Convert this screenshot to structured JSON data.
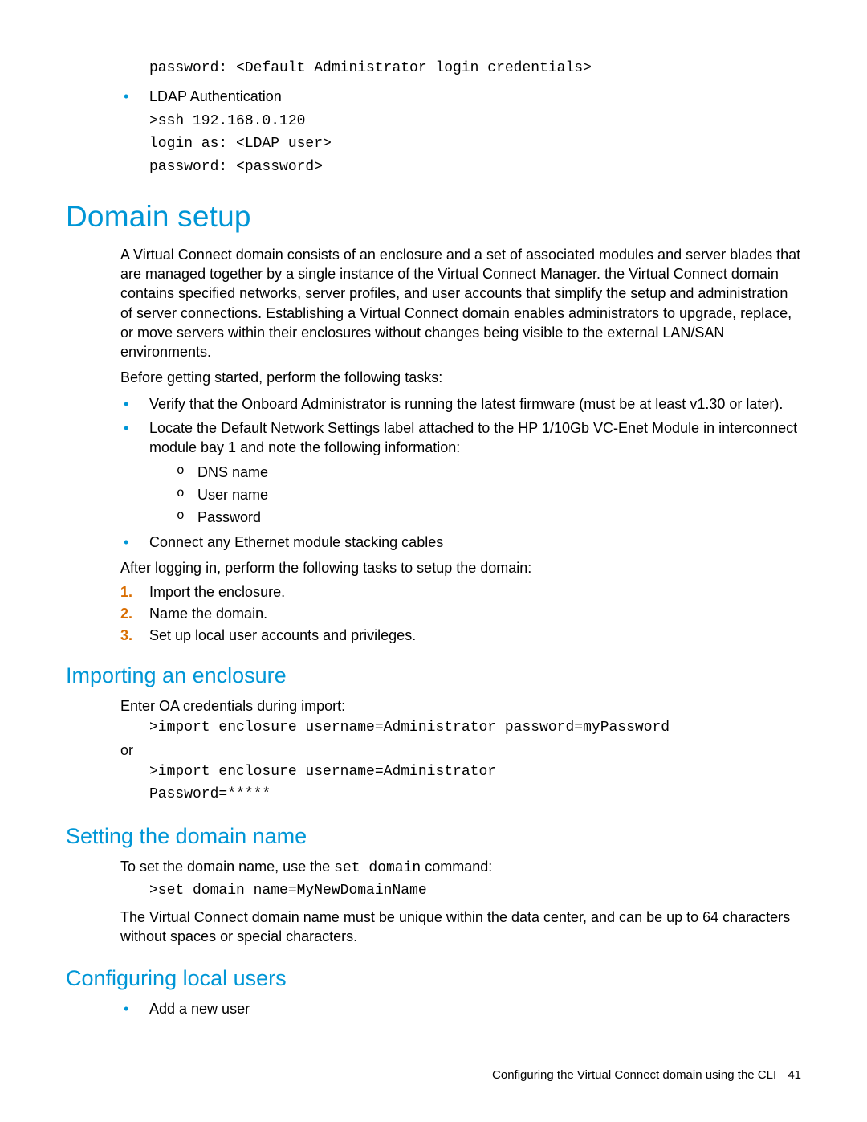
{
  "top_code": {
    "pwd_line": "password: <Default Administrator login credentials>"
  },
  "ldap": {
    "label": "LDAP Authentication",
    "l1": ">ssh 192.168.0.120",
    "l2": "login as: <LDAP user>",
    "l3": "password: <password>"
  },
  "h1_domain": "Domain setup",
  "para1": "A Virtual Connect domain consists of an enclosure and a set of associated modules and server blades that are managed together by a single instance of the Virtual Connect Manager. the Virtual Connect domain contains specified networks, server profiles, and user accounts that simplify the setup and administration of server connections. Establishing a Virtual Connect domain enables administrators to upgrade, replace, or move servers within their enclosures without changes being visible to the external LAN/SAN environments.",
  "para2": "Before getting started, perform the following tasks:",
  "pre_tasks": {
    "b1": "Verify that the Onboard Administrator is running the latest firmware (must be at least v1.30 or later).",
    "b2": "Locate the Default Network Settings label attached to the HP 1/10Gb VC-Enet Module in interconnect module bay 1 and note the following information:",
    "b2_sub": {
      "s1": "DNS name",
      "s2": "User name",
      "s3": "Password"
    },
    "b3": "Connect any Ethernet module stacking cables"
  },
  "para3": "After logging in, perform the following tasks to setup the domain:",
  "steps": {
    "s1": "Import the enclosure.",
    "s2": "Name the domain.",
    "s3": "Set up local user accounts and privileges."
  },
  "h2_import": "Importing an enclosure",
  "import": {
    "p1": "Enter OA credentials during import:",
    "c1": ">import enclosure username=Administrator password=myPassword",
    "or": "or",
    "c2a": ">import enclosure username=Administrator",
    "c2b": "Password=*****"
  },
  "h2_setname": "Setting the domain name",
  "setname": {
    "p1a": "To set the domain name, use the ",
    "p1_code": "set domain",
    "p1b": " command:",
    "c1": ">set domain name=MyNewDomainName",
    "p2": "The Virtual Connect domain name must be unique within the data center, and can be up to 64 characters without spaces or special characters."
  },
  "h2_users": "Configuring local users",
  "users": {
    "b1": "Add a new user"
  },
  "footer": {
    "text": "Configuring the Virtual Connect domain using the CLI",
    "page": "41"
  }
}
